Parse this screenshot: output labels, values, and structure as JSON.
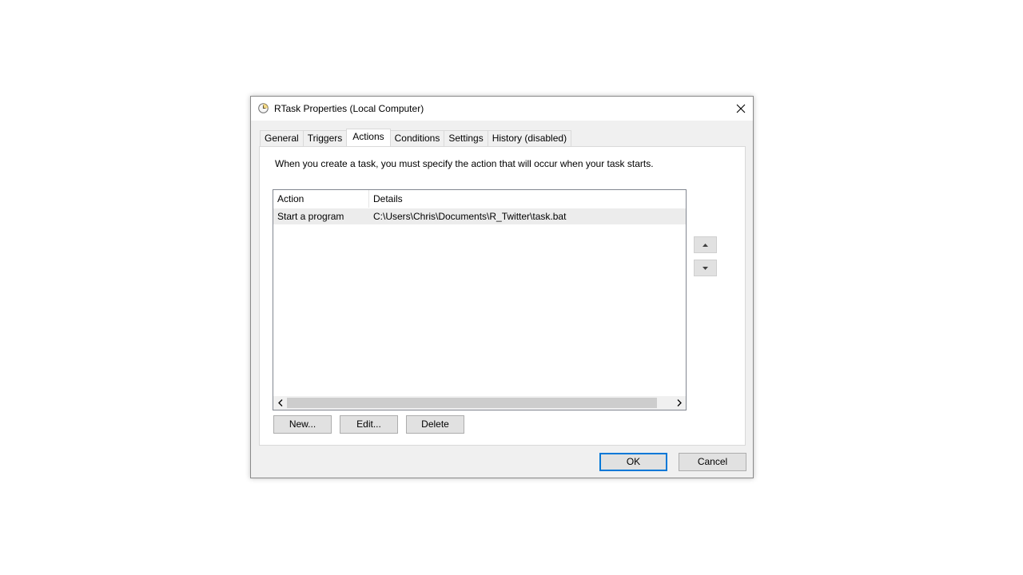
{
  "window": {
    "title": "RTask Properties (Local Computer)",
    "icon": "clock-icon"
  },
  "tabs": [
    {
      "label": "General"
    },
    {
      "label": "Triggers"
    },
    {
      "label": "Actions",
      "active": true
    },
    {
      "label": "Conditions"
    },
    {
      "label": "Settings"
    },
    {
      "label": "History (disabled)"
    }
  ],
  "panel": {
    "description": "When you create a task, you must specify the action that will occur when your task starts."
  },
  "actions_table": {
    "columns": [
      "Action",
      "Details"
    ],
    "rows": [
      {
        "action": "Start a program",
        "details": "C:\\Users\\Chris\\Documents\\R_Twitter\\task.bat"
      }
    ]
  },
  "buttons": {
    "new": "New...",
    "edit": "Edit...",
    "delete": "Delete",
    "ok": "OK",
    "cancel": "Cancel"
  },
  "colors": {
    "accent": "#0078d7",
    "dialog_bg": "#f0f0f0",
    "button_bg": "#e1e1e1"
  }
}
